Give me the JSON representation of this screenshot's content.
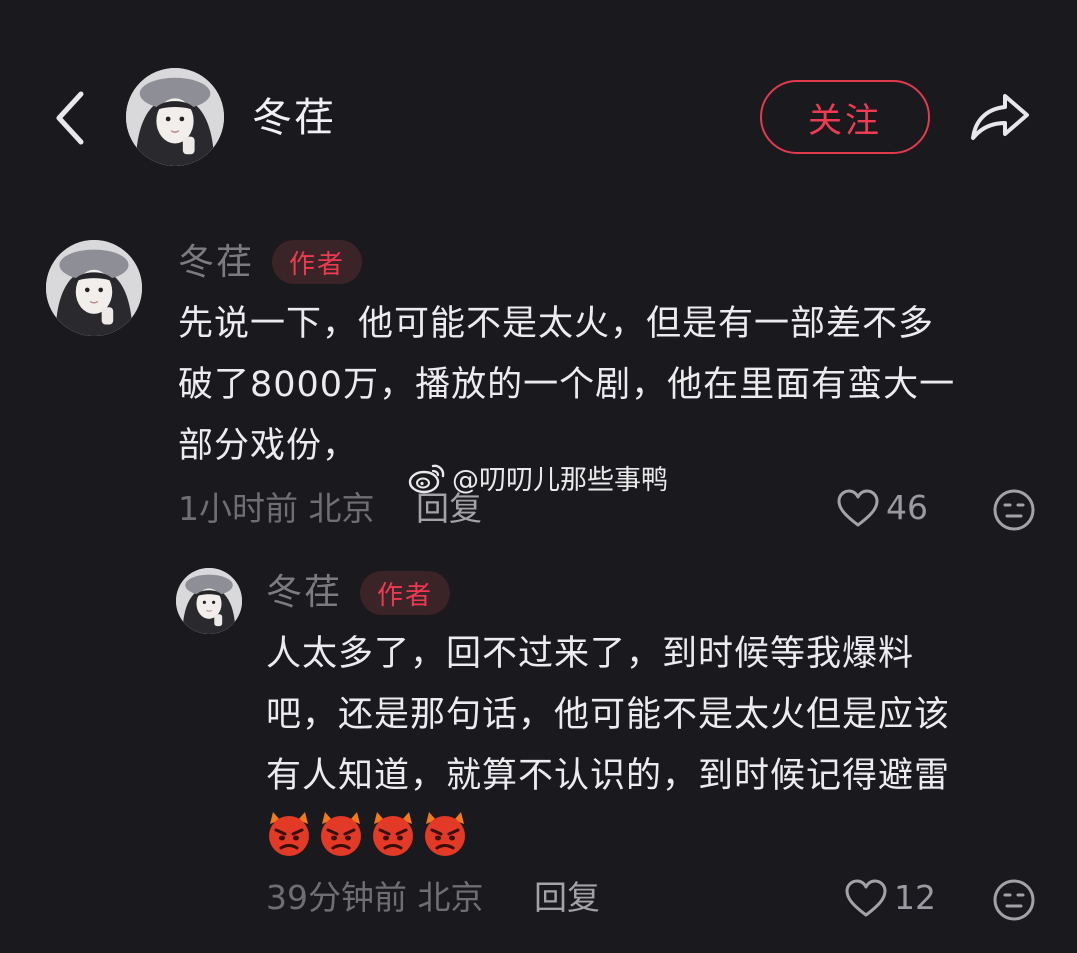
{
  "header": {
    "name": "冬荏",
    "follow_label": "关注",
    "icons": {
      "back": "back-chevron-icon",
      "share": "share-arrow-icon"
    }
  },
  "comments": [
    {
      "name": "冬荏",
      "badge": "作者",
      "text": "先说一下，他可能不是太火，但是有一部差不多\n破了8000万，播放的一个剧，他在里面有蛮大一\n部分戏份，",
      "time_location": "1小时前 北京",
      "reply_label": "回复",
      "likes": "46"
    },
    {
      "name": "冬荏",
      "badge": "作者",
      "text": "人太多了，回不过来了，到时候等我爆料\n吧，还是那句话，他可能不是太火但是应该\n有人知道，就算不认识的，到时候记得避雷",
      "emoji_count": 4,
      "emoji_icon": "angry-devil-emoji-icon",
      "time_location": "39分钟前 北京",
      "reply_label": "回复",
      "likes": "12"
    }
  ],
  "watermark": {
    "text": "@叨叨儿那些事鸭",
    "icon": "weibo-logo-icon"
  },
  "colors": {
    "background": "#1a191d",
    "accent_red": "#ef3b52",
    "badge_bg": "#3a2428",
    "muted_text": "#7c7b80"
  }
}
